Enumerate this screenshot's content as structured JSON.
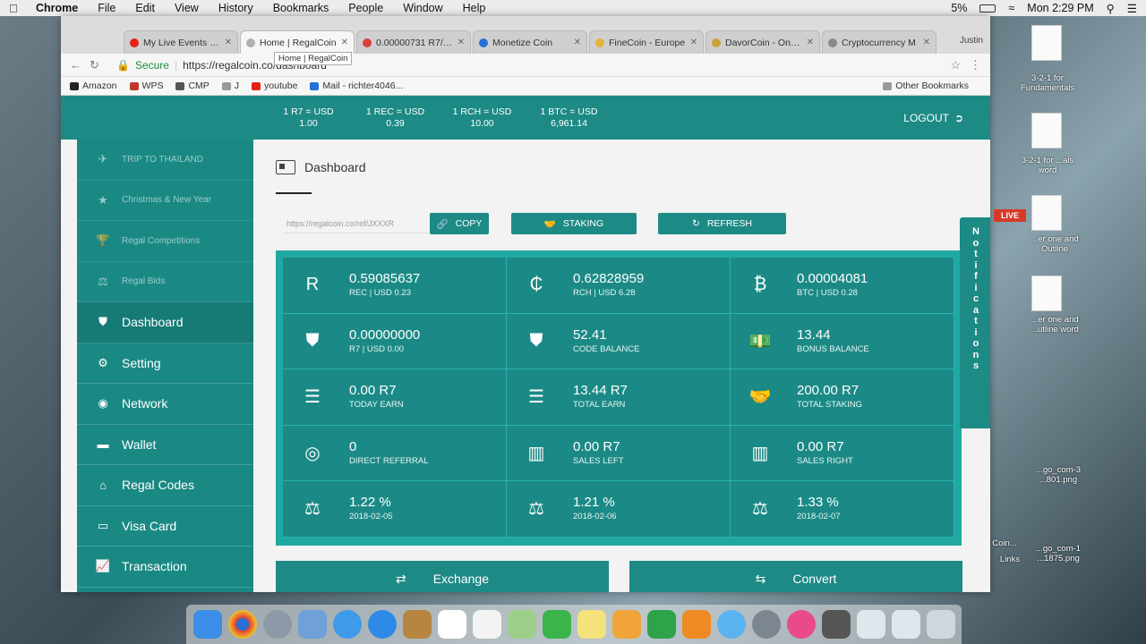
{
  "menubar": {
    "app": "Chrome",
    "items": [
      "File",
      "Edit",
      "View",
      "History",
      "Bookmarks",
      "People",
      "Window",
      "Help"
    ],
    "battery": "5%",
    "clock": "Mon 2:29 PM"
  },
  "tabs": [
    {
      "title": "My Live Events - Y",
      "color": "#e62117"
    },
    {
      "title": "Home | RegalCoin",
      "color": "#b0b0b0",
      "active": true
    },
    {
      "title": "0.00000731 R7/BT",
      "color": "#d9413a"
    },
    {
      "title": "Monetize Coin",
      "color": "#2a6fd6"
    },
    {
      "title": "FineCoin - Europe",
      "color": "#e0b43a"
    },
    {
      "title": "DavorCoin - One o",
      "color": "#c9a23a"
    },
    {
      "title": "Cryptocurrency M",
      "color": "#888888"
    }
  ],
  "tab_user": "Justin",
  "tooltip": "Home | RegalCoin",
  "address": {
    "secure_label": "Secure",
    "url": "https://regalcoin.co/dashboard"
  },
  "bookmarks": [
    {
      "label": "Amazon",
      "color": "#222222"
    },
    {
      "label": "WPS",
      "color": "#c0392b"
    },
    {
      "label": "CMP",
      "color": "#555555"
    },
    {
      "label": "J",
      "color": "#999999"
    },
    {
      "label": "youtube",
      "color": "#e62117"
    },
    {
      "label": "Mail - richter4046...",
      "color": "#2a6fd6"
    }
  ],
  "other_bookmarks": "Other Bookmarks",
  "rates": [
    {
      "label": "1 R7 = USD",
      "value": "1.00"
    },
    {
      "label": "1 REC = USD",
      "value": "0.39"
    },
    {
      "label": "1 RCH = USD",
      "value": "10.00"
    },
    {
      "label": "1 BTC = USD",
      "value": "6,961.14"
    }
  ],
  "logout": "LOGOUT",
  "sidebar": [
    {
      "label": "TRIP TO THAILAND",
      "icon": "plane-icon",
      "faded": true
    },
    {
      "label": "Christmas & New Year",
      "icon": "star-icon",
      "faded": true
    },
    {
      "label": "Regal Competitions",
      "icon": "trophy-icon",
      "faded": true
    },
    {
      "label": "Regal Bids",
      "icon": "balance-icon",
      "faded": true
    },
    {
      "label": "Dashboard",
      "icon": "shield-icon",
      "active": true
    },
    {
      "label": "Setting",
      "icon": "gears-icon"
    },
    {
      "label": "Network",
      "icon": "network-icon"
    },
    {
      "label": "Wallet",
      "icon": "wallet-icon"
    },
    {
      "label": "Regal Codes",
      "icon": "tag-icon"
    },
    {
      "label": "Visa Card",
      "icon": "credit-card-icon"
    },
    {
      "label": "Transaction",
      "icon": "line-chart-icon"
    }
  ],
  "dashboard": {
    "title": "Dashboard",
    "ref_link": "https://regalcoin.co/ref/JXXXR",
    "copy": "COPY",
    "staking": "STAKING",
    "refresh": "REFRESH"
  },
  "stats": [
    {
      "value": "0.59085637",
      "label": "REC | USD 0.23",
      "icon": "rec-icon"
    },
    {
      "value": "0.62828959",
      "label": "RCH | USD 6.28",
      "icon": "rch-icon"
    },
    {
      "value": "0.00004081",
      "label": "BTC | USD 0.28",
      "icon": "bitcoin-icon"
    },
    {
      "value": "0.00000000",
      "label": "R7 | USD 0.00",
      "icon": "shield-icon"
    },
    {
      "value": "52.41",
      "label": "CODE BALANCE",
      "icon": "shield-icon"
    },
    {
      "value": "13.44",
      "label": "BONUS BALANCE",
      "icon": "money-icon"
    },
    {
      "value": "0.00 R7",
      "label": "TODAY EARN",
      "icon": "coins-stack-icon"
    },
    {
      "value": "13.44 R7",
      "label": "TOTAL EARN",
      "icon": "coins-stack-icon"
    },
    {
      "value": "200.00 R7",
      "label": "TOTAL STAKING",
      "icon": "handshake-icon"
    },
    {
      "value": "0",
      "label": "DIRECT REFERRAL",
      "icon": "user-circle-icon"
    },
    {
      "value": "0.00 R7",
      "label": "SALES LEFT",
      "icon": "bar-chart-icon"
    },
    {
      "value": "0.00 R7",
      "label": "SALES RIGHT",
      "icon": "bar-chart-icon"
    },
    {
      "value": "1.22 %",
      "label": "2018-02-05",
      "icon": "scale-icon"
    },
    {
      "value": "1.21 %",
      "label": "2018-02-06",
      "icon": "scale-icon"
    },
    {
      "value": "1.33 %",
      "label": "2018-02-07",
      "icon": "scale-icon"
    }
  ],
  "exchange": "Exchange",
  "convert": "Convert",
  "notifications": "Notifications",
  "desktop": {
    "labels": [
      "3-2-1 for Fundamentals",
      "3-2-1 for ...als word",
      "...er one and Outline",
      "...er one and ...utline word",
      "...go_com-3 ...801.png",
      "...go_com-1 ...1875.png"
    ],
    "live": "LIVE",
    "coin_label": "Coin...",
    "links_label": "Links"
  }
}
